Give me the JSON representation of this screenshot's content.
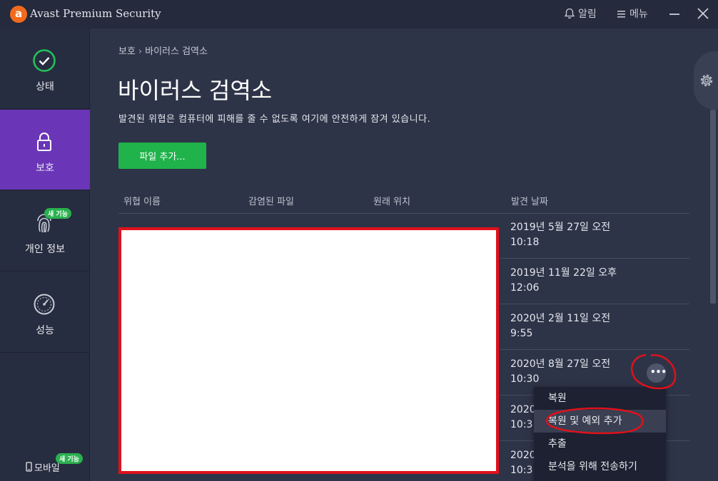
{
  "window": {
    "title": "Avast Premium Security",
    "alerts_label": "알림",
    "menu_label": "메뉴"
  },
  "sidebar": {
    "items": [
      {
        "label": "상태",
        "icon": "check-circle-icon",
        "active": false
      },
      {
        "label": "보호",
        "icon": "lock-icon",
        "active": true
      },
      {
        "label": "개인 정보",
        "icon": "fingerprint-icon",
        "badge": "새 기능",
        "active": false
      },
      {
        "label": "성능",
        "icon": "speedometer-icon",
        "active": false
      }
    ],
    "mobile": {
      "label": "모바일",
      "badge": "새 기능",
      "icon": "phone-icon"
    }
  },
  "breadcrumb": {
    "parent": "보호",
    "separator": "›",
    "current": "바이러스 검역소"
  },
  "page": {
    "title": "바이러스 검역소",
    "description": "발견된 위협은 컴퓨터에 피해를 줄 수 없도록 여기에 안전하게 잠겨 있습니다.",
    "add_file_button": "파일 추가..."
  },
  "table": {
    "columns": [
      "위협 이름",
      "감염된 파일",
      "원래 위치",
      "발견 날짜"
    ],
    "rows": [
      {
        "date_line1": "2019년 5월 27일 오전",
        "date_line2": "10:18"
      },
      {
        "date_line1": "2019년 11월 22일 오후",
        "date_line2": "12:06"
      },
      {
        "date_line1": "2020년 2월 11일 오전",
        "date_line2": "9:55"
      },
      {
        "date_line1": "2020년 8월 27일 오전",
        "date_line2": "10:30"
      },
      {
        "date_line1": "2020",
        "date_line2": "10:3"
      },
      {
        "date_line1": "2020",
        "date_line2": "10:3"
      }
    ]
  },
  "context_menu": {
    "items": [
      "복원",
      "복원 및 예외 추가",
      "추출",
      "분석을 위해 전송하기"
    ],
    "highlighted_index": 1
  },
  "colors": {
    "accent_purple": "#6b35b8",
    "button_green": "#20b24b",
    "avast_orange": "#f26b1d",
    "annotation_red": "#e0111b"
  }
}
